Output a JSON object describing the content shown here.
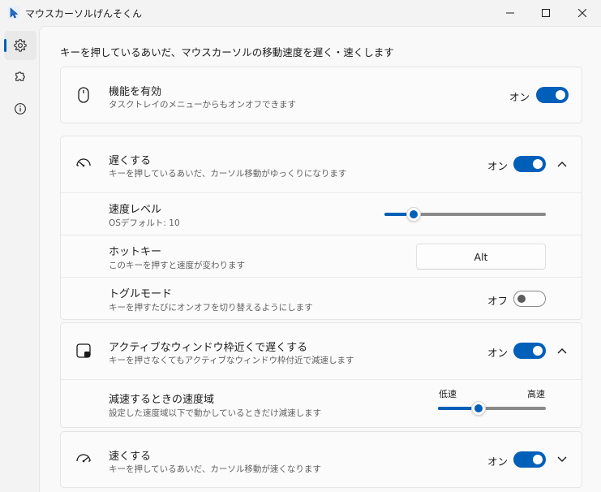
{
  "window": {
    "title": "マウスカーソルげんそくん",
    "icons": [
      "cursor-app-icon",
      "minimize-icon",
      "maximize-icon",
      "close-icon"
    ]
  },
  "sidebar": {
    "items": [
      {
        "id": "settings",
        "icon": "gear-icon",
        "active": true
      },
      {
        "id": "extensions",
        "icon": "puzzle-icon",
        "active": false
      },
      {
        "id": "about",
        "icon": "info-icon",
        "active": false
      }
    ]
  },
  "page": {
    "description": "キーを押しているあいだ、マウスカーソルの移動速度を遅く・速くします"
  },
  "enable_card": {
    "icon": "mouse-icon",
    "title": "機能を有効",
    "subtitle": "タスクトレイのメニューからもオンオフできます",
    "toggle_label": "オン",
    "toggle_on": true
  },
  "slow_card": {
    "icon": "speedometer-slow-icon",
    "title": "遅くする",
    "subtitle": "キーを押しているあいだ、カーソル移動がゆっくりになります",
    "toggle_label": "オン",
    "toggle_on": true,
    "expanded": true,
    "speed_level": {
      "title": "速度レベル",
      "subtitle": "OSデフォルト: 10",
      "value_fraction": 0.15
    },
    "hotkey": {
      "title": "ホットキー",
      "subtitle": "このキーを押すと速度が変わります",
      "value": "Alt"
    },
    "toggle_mode": {
      "title": "トグルモード",
      "subtitle": "キーを押すたびにオンオフを切り替えるようにします",
      "toggle_label": "オフ",
      "toggle_on": false
    }
  },
  "window_card": {
    "icon": "window-corner-icon",
    "title": "アクティブなウィンドウ枠近くで遅くする",
    "subtitle": "キーを押さなくてもアクティブなウィンドウ枠付近で減速します",
    "toggle_label": "オン",
    "toggle_on": true,
    "expanded": true,
    "speed_range": {
      "title": "減速するときの速度域",
      "subtitle": "設定した速度域以下で動かしているときだけ減速します",
      "low_label": "低速",
      "high_label": "高速",
      "value_fraction": 0.36
    }
  },
  "fast_card": {
    "icon": "speedometer-fast-icon",
    "title": "速くする",
    "subtitle": "キーを押しているあいだ、カーソル移動が速くなります",
    "toggle_label": "オン",
    "toggle_on": true,
    "expanded": false
  },
  "colors": {
    "accent": "#005fb8",
    "card_background": "#fbfbfb",
    "window_background": "#f3f3f3"
  }
}
